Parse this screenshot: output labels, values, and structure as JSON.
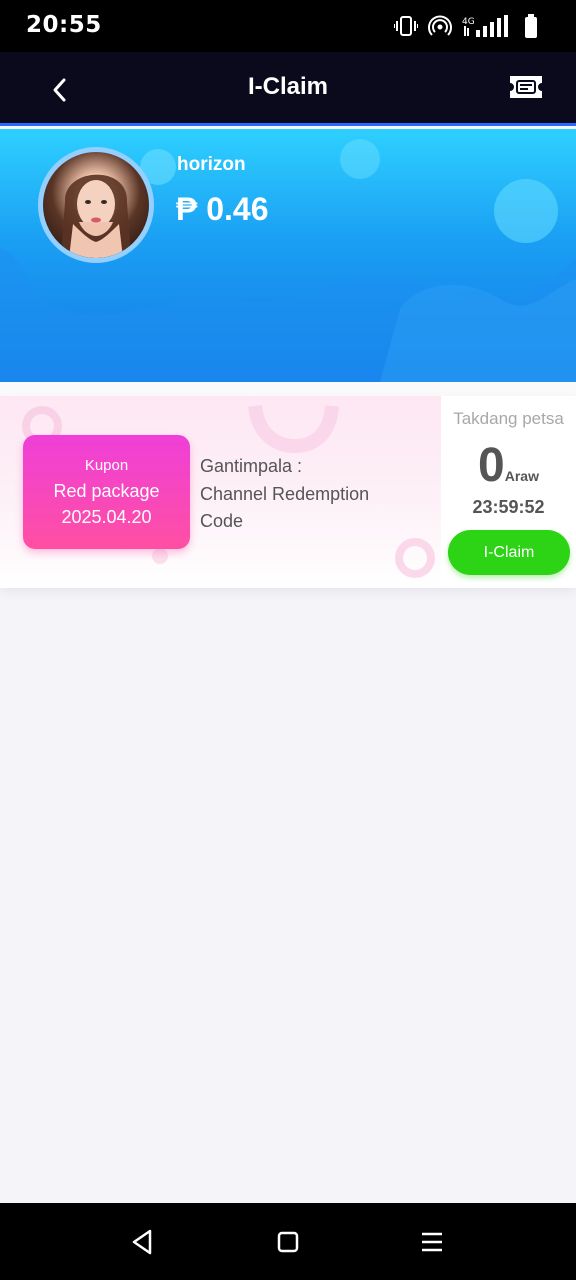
{
  "status_bar": {
    "time": "20:55",
    "icons": [
      "vibrate-icon",
      "hotspot-icon",
      "4g-signal-icon",
      "battery-icon"
    ]
  },
  "header": {
    "title": "I-Claim",
    "back_icon": "chevron-left-icon",
    "right_icon": "ticket-icon"
  },
  "profile": {
    "username": "horizon",
    "balance": "₱ 0.46"
  },
  "coupon": {
    "type": "Kupon",
    "name": "Red package",
    "date": "2025.04.20",
    "desc_line1": "Gantimpala :",
    "desc_line2": "Channel Redemption",
    "desc_line3": "Code",
    "time_label": "Takdang petsa",
    "days_value": "0",
    "days_unit": "Araw",
    "countdown": "23:59:52",
    "claim_label": "I-Claim"
  },
  "nav": {
    "icons": [
      "back-triangle-icon",
      "home-square-icon",
      "menu-lines-icon"
    ]
  },
  "colors": {
    "header_bg": "#0b0a1c",
    "hero_top": "#2ed0ff",
    "hero_bottom": "#147ae8",
    "coupon_tag": "#ef3fd8",
    "claim_button": "#2dd315"
  }
}
